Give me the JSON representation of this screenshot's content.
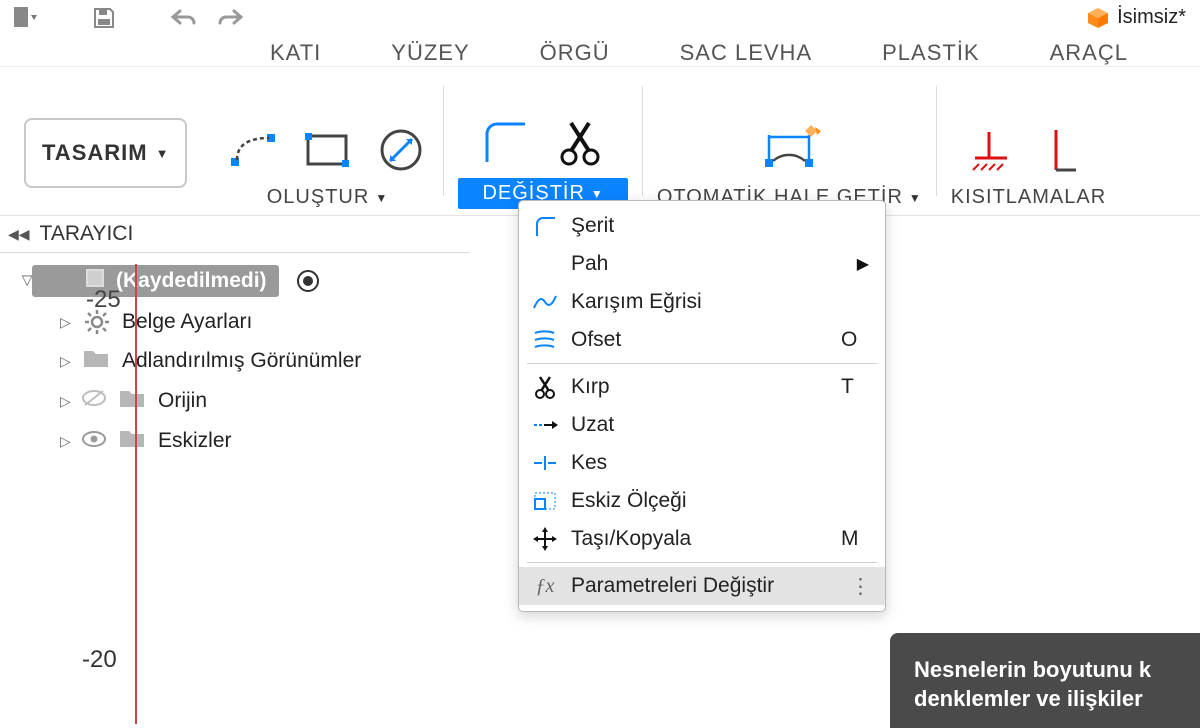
{
  "title": "İsimsiz*",
  "topbar": {
    "icons": [
      "file-dropdown",
      "save",
      "undo",
      "redo"
    ]
  },
  "tabs": [
    "KATI",
    "YÜZEY",
    "ÖRGÜ",
    "SAC LEVHA",
    "PLASTİK",
    "ARAÇL"
  ],
  "ribbon": {
    "design_button": "TASARIM",
    "sections": {
      "create": "OLUŞTUR",
      "modify": "DEĞİŞTİR",
      "automate": "OTOMATİK HALE GETİR",
      "constraints": "KISITLAMALAR"
    }
  },
  "browser": {
    "header": "TARAYICI",
    "root": "(Kaydedilmedi)",
    "items": [
      {
        "label": "Belge Ayarları",
        "icon": "gear"
      },
      {
        "label": "Adlandırılmış Görünümler",
        "icon": "folder"
      },
      {
        "label": "Orijin",
        "icon": "folder",
        "hidden": true
      },
      {
        "label": "Eskizler",
        "icon": "folder"
      }
    ],
    "ruler_top": "-25",
    "ruler_bottom": "-20"
  },
  "menu": {
    "items": [
      {
        "id": "serit",
        "label": "Şerit",
        "icon": "arc",
        "shortcut": "",
        "sub": false
      },
      {
        "id": "pah",
        "label": "Pah",
        "icon": "",
        "shortcut": "",
        "sub": true
      },
      {
        "id": "karisim",
        "label": "Karışım Eğrisi",
        "icon": "wave",
        "shortcut": "",
        "sub": false
      },
      {
        "id": "ofset",
        "label": "Ofset",
        "icon": "offset",
        "shortcut": "O",
        "sub": false,
        "sep_after": true
      },
      {
        "id": "kirp",
        "label": "Kırp",
        "icon": "scissors",
        "shortcut": "T",
        "sub": false
      },
      {
        "id": "uzat",
        "label": "Uzat",
        "icon": "extend",
        "shortcut": "",
        "sub": false
      },
      {
        "id": "kes",
        "label": "Kes",
        "icon": "break",
        "shortcut": "",
        "sub": false
      },
      {
        "id": "olcek",
        "label": "Eskiz Ölçeği",
        "icon": "scale",
        "shortcut": "",
        "sub": false
      },
      {
        "id": "tasi",
        "label": "Taşı/Kopyala",
        "icon": "move",
        "shortcut": "M",
        "sub": false,
        "sep_after": true
      },
      {
        "id": "param",
        "label": "Parametreleri Değiştir",
        "icon": "fx",
        "shortcut": "",
        "sub": false,
        "selected": true
      }
    ]
  },
  "tooltip": {
    "line1": "Nesnelerin boyutunu k",
    "line2": "denklemler ve ilişkiler"
  }
}
